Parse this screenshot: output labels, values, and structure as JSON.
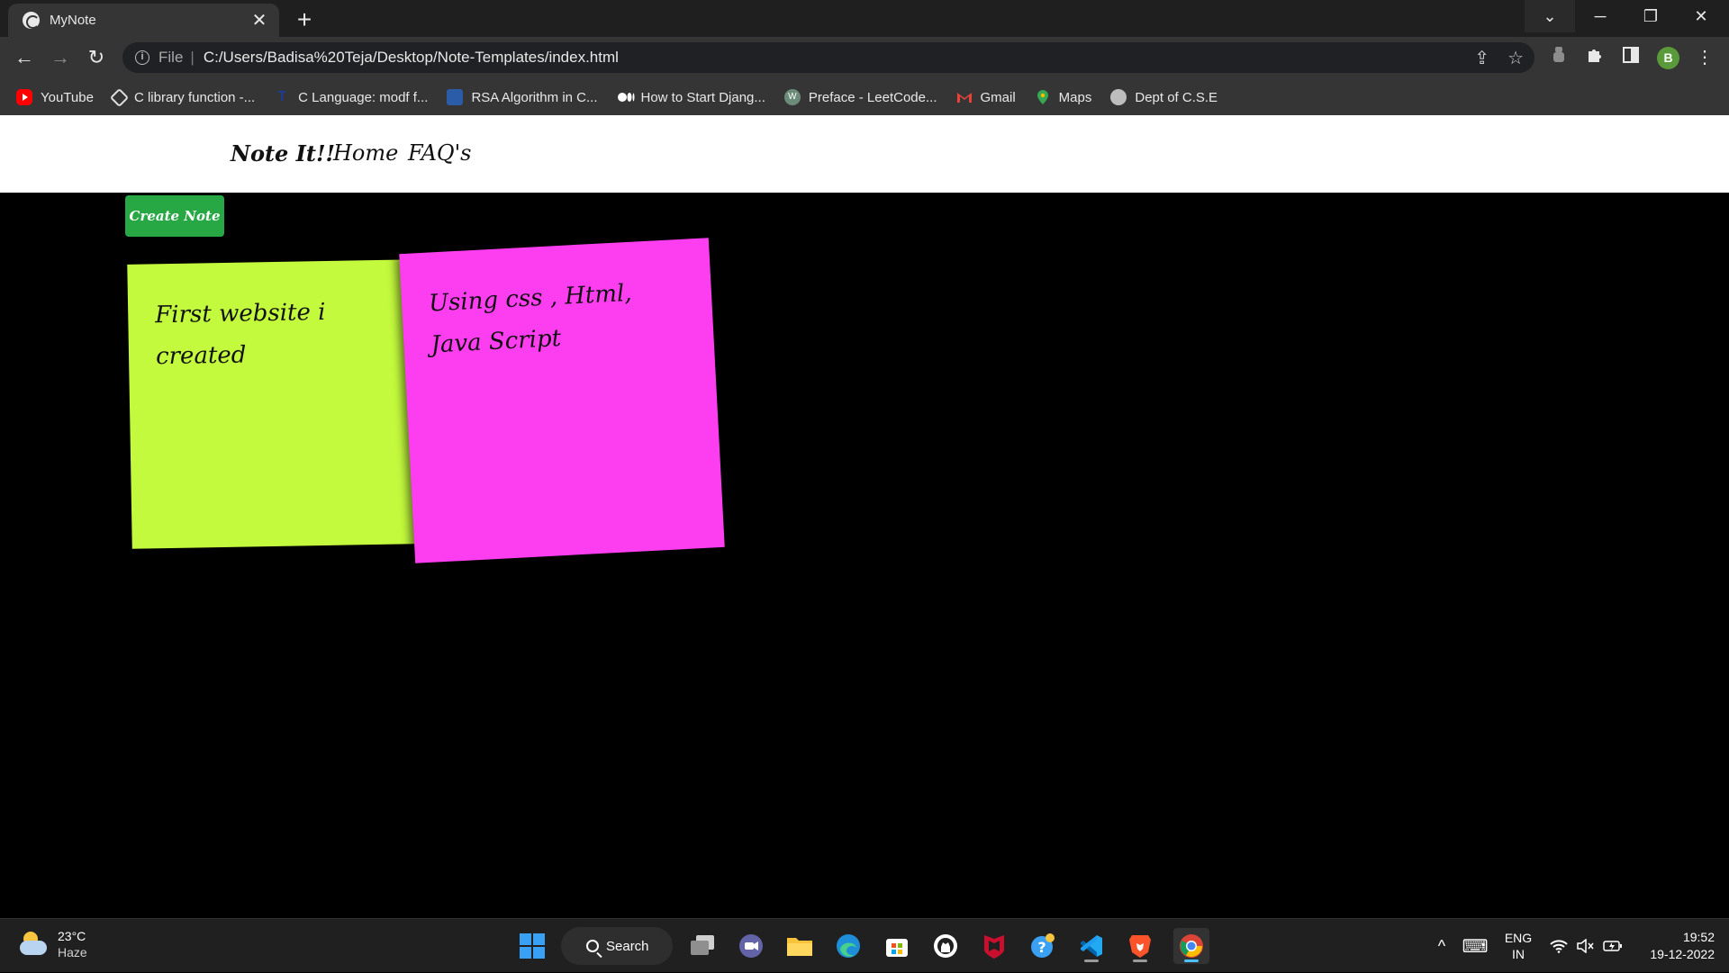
{
  "browser": {
    "tab_title": "MyNote",
    "tab_close": "✕",
    "new_tab": "+",
    "window_controls": {
      "tab_search": "⌄",
      "minimize": "─",
      "restore": "❐",
      "close": "✕"
    },
    "nav": {
      "back": "←",
      "forward": "→",
      "reload": "↻"
    },
    "address": {
      "scheme": "File",
      "url": "C:/Users/Badisa%20Teja/Desktop/Note-Templates/index.html"
    },
    "profile_initial": "B",
    "bookmarks": [
      {
        "label": "YouTube",
        "icon": "youtube-icon",
        "color": "#ff0000"
      },
      {
        "label": "C library function -...",
        "icon": "globe-icon",
        "color": "#e0e0e0"
      },
      {
        "label": "C Language: modf f...",
        "icon": "techonthenet-icon",
        "color": "#1d3c8f"
      },
      {
        "label": "RSA Algorithm in C...",
        "icon": "sanfoundry-icon",
        "color": "#2b5ca8"
      },
      {
        "label": "How to Start Djang...",
        "icon": "medium-icon",
        "color": "#ffffff"
      },
      {
        "label": "Preface - LeetCode...",
        "icon": "leetcode-wiki-icon",
        "color": "#6c8b7a"
      },
      {
        "label": "Gmail",
        "icon": "gmail-icon",
        "color": "#ea4335"
      },
      {
        "label": "Maps",
        "icon": "maps-icon",
        "color": "#34a853"
      },
      {
        "label": "Dept of C.S.E",
        "icon": "globe-icon",
        "color": "#bdbdbd"
      }
    ]
  },
  "site": {
    "nav": {
      "brand": "Note It!!",
      "home": "Home",
      "faq": "FAQ's"
    },
    "create_button": "Create Note",
    "notes": [
      {
        "text": "First website i created",
        "color": "#c3fa3d"
      },
      {
        "text": "Using css , Html, Java Script",
        "color": "#fd3df0"
      }
    ]
  },
  "taskbar": {
    "weather": {
      "temp": "23°C",
      "condition": "Haze"
    },
    "search_label": "Search",
    "apps": [
      "start-icon",
      "task-view-icon",
      "teams-chat-icon",
      "file-explorer-icon",
      "edge-icon",
      "microsoft-store-icon",
      "github-icon",
      "mcafee-icon",
      "help-icon",
      "vscode-icon",
      "brave-icon",
      "chrome-icon"
    ],
    "tray": {
      "chevron": "^",
      "keyboard": "⌨",
      "language_line1": "ENG",
      "language_line2": "IN",
      "time": "19:52",
      "date": "19-12-2022"
    }
  }
}
